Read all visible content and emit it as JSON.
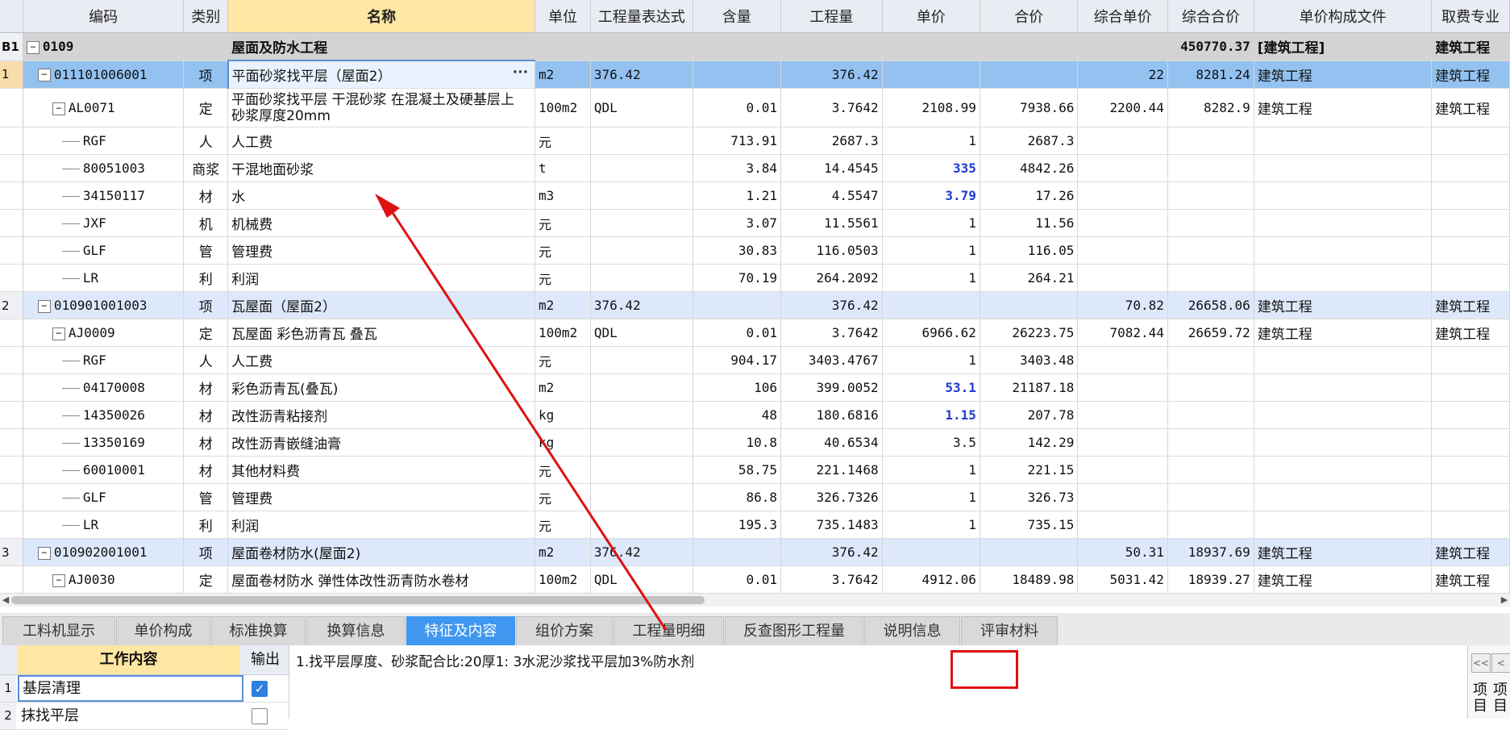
{
  "columns": {
    "row_no": "",
    "code": "编码",
    "type": "类别",
    "name": "名称",
    "unit": "单位",
    "expr": "工程量表达式",
    "content": "含量",
    "qty": "工程量",
    "price": "单价",
    "total": "合价",
    "comp_price": "综合单价",
    "comp_total": "综合合价",
    "price_file": "单价构成文件",
    "fee": "取费专业"
  },
  "rows": [
    {
      "rn": "B1",
      "code": "0109",
      "type": "",
      "name": "屋面及防水工程",
      "unit": "",
      "expr": "",
      "content": "",
      "qty": "",
      "price": "",
      "total": "",
      "comp_price": "",
      "comp_total": "450770.37",
      "price_file": "[建筑工程]",
      "fee": "建筑工程"
    },
    {
      "rn": "1",
      "code": "011101006001",
      "type": "项",
      "name": "平面砂浆找平层（屋面2）",
      "unit": "m2",
      "expr": "376.42",
      "content": "",
      "qty": "376.42",
      "price": "",
      "total": "",
      "comp_price": "22",
      "comp_total": "8281.24",
      "price_file": "建筑工程",
      "fee": "建筑工程"
    },
    {
      "rn": "",
      "code": "AL0071",
      "type": "定",
      "name": "平面砂浆找平层 干混砂浆 在混凝土及硬基层上 砂浆厚度20mm",
      "unit": "100m2",
      "expr": "QDL",
      "content": "0.01",
      "qty": "3.7642",
      "price": "2108.99",
      "total": "7938.66",
      "comp_price": "2200.44",
      "comp_total": "8282.9",
      "price_file": "建筑工程",
      "fee": "建筑工程"
    },
    {
      "rn": "",
      "code": "RGF",
      "type": "人",
      "name": "人工费",
      "unit": "元",
      "expr": "",
      "content": "713.91",
      "qty": "2687.3",
      "price": "1",
      "total": "2687.3",
      "comp_price": "",
      "comp_total": "",
      "price_file": "",
      "fee": ""
    },
    {
      "rn": "",
      "code": "80051003",
      "type": "商浆",
      "name": "干混地面砂浆",
      "unit": "t",
      "expr": "",
      "content": "3.84",
      "qty": "14.4545",
      "price": "335",
      "total": "4842.26",
      "comp_price": "",
      "comp_total": "",
      "price_file": "",
      "fee": ""
    },
    {
      "rn": "",
      "code": "34150117",
      "type": "材",
      "name": "水",
      "unit": "m3",
      "expr": "",
      "content": "1.21",
      "qty": "4.5547",
      "price": "3.79",
      "total": "17.26",
      "comp_price": "",
      "comp_total": "",
      "price_file": "",
      "fee": ""
    },
    {
      "rn": "",
      "code": "JXF",
      "type": "机",
      "name": "机械费",
      "unit": "元",
      "expr": "",
      "content": "3.07",
      "qty": "11.5561",
      "price": "1",
      "total": "11.56",
      "comp_price": "",
      "comp_total": "",
      "price_file": "",
      "fee": ""
    },
    {
      "rn": "",
      "code": "GLF",
      "type": "管",
      "name": "管理费",
      "unit": "元",
      "expr": "",
      "content": "30.83",
      "qty": "116.0503",
      "price": "1",
      "total": "116.05",
      "comp_price": "",
      "comp_total": "",
      "price_file": "",
      "fee": ""
    },
    {
      "rn": "",
      "code": "LR",
      "type": "利",
      "name": "利润",
      "unit": "元",
      "expr": "",
      "content": "70.19",
      "qty": "264.2092",
      "price": "1",
      "total": "264.21",
      "comp_price": "",
      "comp_total": "",
      "price_file": "",
      "fee": ""
    },
    {
      "rn": "2",
      "code": "010901001003",
      "type": "项",
      "name": "瓦屋面（屋面2）",
      "unit": "m2",
      "expr": "376.42",
      "content": "",
      "qty": "376.42",
      "price": "",
      "total": "",
      "comp_price": "70.82",
      "comp_total": "26658.06",
      "price_file": "建筑工程",
      "fee": "建筑工程"
    },
    {
      "rn": "",
      "code": "AJ0009",
      "type": "定",
      "name": "瓦屋面 彩色沥青瓦 叠瓦",
      "unit": "100m2",
      "expr": "QDL",
      "content": "0.01",
      "qty": "3.7642",
      "price": "6966.62",
      "total": "26223.75",
      "comp_price": "7082.44",
      "comp_total": "26659.72",
      "price_file": "建筑工程",
      "fee": "建筑工程"
    },
    {
      "rn": "",
      "code": "RGF",
      "type": "人",
      "name": "人工费",
      "unit": "元",
      "expr": "",
      "content": "904.17",
      "qty": "3403.4767",
      "price": "1",
      "total": "3403.48",
      "comp_price": "",
      "comp_total": "",
      "price_file": "",
      "fee": ""
    },
    {
      "rn": "",
      "code": "04170008",
      "type": "材",
      "name": "彩色沥青瓦(叠瓦)",
      "unit": "m2",
      "expr": "",
      "content": "106",
      "qty": "399.0052",
      "price": "53.1",
      "total": "21187.18",
      "comp_price": "",
      "comp_total": "",
      "price_file": "",
      "fee": ""
    },
    {
      "rn": "",
      "code": "14350026",
      "type": "材",
      "name": "改性沥青粘接剂",
      "unit": "kg",
      "expr": "",
      "content": "48",
      "qty": "180.6816",
      "price": "1.15",
      "total": "207.78",
      "comp_price": "",
      "comp_total": "",
      "price_file": "",
      "fee": ""
    },
    {
      "rn": "",
      "code": "13350169",
      "type": "材",
      "name": "改性沥青嵌缝油膏",
      "unit": "kg",
      "expr": "",
      "content": "10.8",
      "qty": "40.6534",
      "price": "3.5",
      "total": "142.29",
      "comp_price": "",
      "comp_total": "",
      "price_file": "",
      "fee": ""
    },
    {
      "rn": "",
      "code": "60010001",
      "type": "材",
      "name": "其他材料费",
      "unit": "元",
      "expr": "",
      "content": "58.75",
      "qty": "221.1468",
      "price": "1",
      "total": "221.15",
      "comp_price": "",
      "comp_total": "",
      "price_file": "",
      "fee": ""
    },
    {
      "rn": "",
      "code": "GLF",
      "type": "管",
      "name": "管理费",
      "unit": "元",
      "expr": "",
      "content": "86.8",
      "qty": "326.7326",
      "price": "1",
      "total": "326.73",
      "comp_price": "",
      "comp_total": "",
      "price_file": "",
      "fee": ""
    },
    {
      "rn": "",
      "code": "LR",
      "type": "利",
      "name": "利润",
      "unit": "元",
      "expr": "",
      "content": "195.3",
      "qty": "735.1483",
      "price": "1",
      "total": "735.15",
      "comp_price": "",
      "comp_total": "",
      "price_file": "",
      "fee": ""
    },
    {
      "rn": "3",
      "code": "010902001001",
      "type": "项",
      "name": "屋面卷材防水(屋面2)",
      "unit": "m2",
      "expr": "376.42",
      "content": "",
      "qty": "376.42",
      "price": "",
      "total": "",
      "comp_price": "50.31",
      "comp_total": "18937.69",
      "price_file": "建筑工程",
      "fee": "建筑工程"
    },
    {
      "rn": "",
      "code": "AJ0030",
      "type": "定",
      "name": "屋面卷材防水 弹性体改性沥青防水卷材",
      "unit": "100m2",
      "expr": "QDL",
      "content": "0.01",
      "qty": "3.7642",
      "price": "4912.06",
      "total": "18489.98",
      "comp_price": "5031.42",
      "comp_total": "18939.27",
      "price_file": "建筑工程",
      "fee": "建筑工程"
    }
  ],
  "tabs": [
    "工料机显示",
    "单价构成",
    "标准换算",
    "换算信息",
    "特征及内容",
    "组价方案",
    "工程量明细",
    "反查图形工程量",
    "说明信息",
    "评审材料"
  ],
  "active_tab": "特征及内容",
  "work_content": {
    "header_name": "工作内容",
    "header_output": "输出",
    "items": [
      {
        "n": "1",
        "label": "基层清理",
        "checked": true
      },
      {
        "n": "2",
        "label": "抹找平层",
        "checked": false
      }
    ]
  },
  "feature_text": "1.找平层厚度、砂浆配合比:20厚1: 3水泥沙浆找平层加3%防水剂",
  "right_nav": {
    "btn1": "<<",
    "btn2": "<",
    "label1": "项目",
    "label2": "项目"
  },
  "colors": {
    "accent": "#3f97f0",
    "annotation": "#e01010",
    "selected_row": "#93c2f0",
    "bill_row": "#dde8fb",
    "header": "#e9ecf2",
    "highlight_header": "#ffe6a3",
    "price_blue": "#1e3cd2"
  }
}
